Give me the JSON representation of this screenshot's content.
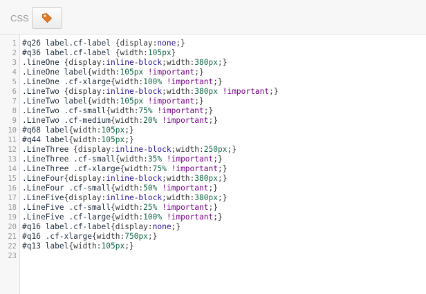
{
  "toolbar": {
    "mode_label": "CSS",
    "tag_button_icon": "tag-icon",
    "accent": "#e07a26"
  },
  "editor": {
    "lines": [
      [
        [
          "#q26 label.cf-label ",
          "sel"
        ],
        [
          "{",
          "punc"
        ],
        [
          "display",
          "prop"
        ],
        [
          ":",
          "punc"
        ],
        [
          "none",
          "kw"
        ],
        [
          ";}",
          "punc"
        ]
      ],
      [
        [
          "#q36 label.cf-label ",
          "sel"
        ],
        [
          "{",
          "punc"
        ],
        [
          "width",
          "prop"
        ],
        [
          ":",
          "punc"
        ],
        [
          "105px",
          "val"
        ],
        [
          "}",
          "punc"
        ]
      ],
      [
        [
          ".lineOne ",
          "sel"
        ],
        [
          "{",
          "punc"
        ],
        [
          "display",
          "prop"
        ],
        [
          ":",
          "punc"
        ],
        [
          "inline-block",
          "kw"
        ],
        [
          ";",
          "punc"
        ],
        [
          "width",
          "prop"
        ],
        [
          ":",
          "punc"
        ],
        [
          "380px",
          "val"
        ],
        [
          ";}",
          "punc"
        ]
      ],
      [
        [
          ".LineOne label",
          "sel"
        ],
        [
          "{",
          "punc"
        ],
        [
          "width",
          "prop"
        ],
        [
          ":",
          "punc"
        ],
        [
          "105px ",
          "val"
        ],
        [
          "!important",
          "imp"
        ],
        [
          ";}",
          "punc"
        ]
      ],
      [
        [
          ".LineOne .cf-xlarge",
          "sel"
        ],
        [
          "{",
          "punc"
        ],
        [
          "width",
          "prop"
        ],
        [
          ":",
          "punc"
        ],
        [
          "100% ",
          "val"
        ],
        [
          "!important",
          "imp"
        ],
        [
          ";}",
          "punc"
        ]
      ],
      [
        [
          ".LineTwo ",
          "sel"
        ],
        [
          "{",
          "punc"
        ],
        [
          "display",
          "prop"
        ],
        [
          ":",
          "punc"
        ],
        [
          "inline-block",
          "kw"
        ],
        [
          ";",
          "punc"
        ],
        [
          "width",
          "prop"
        ],
        [
          ":",
          "punc"
        ],
        [
          "380px ",
          "val"
        ],
        [
          "!important",
          "imp"
        ],
        [
          ";}",
          "punc"
        ]
      ],
      [
        [
          ".LineTwo label",
          "sel"
        ],
        [
          "{",
          "punc"
        ],
        [
          "width",
          "prop"
        ],
        [
          ":",
          "punc"
        ],
        [
          "105px ",
          "val"
        ],
        [
          "!important",
          "imp"
        ],
        [
          ";}",
          "punc"
        ]
      ],
      [
        [
          ".LineTwo .cf-small",
          "sel"
        ],
        [
          "{",
          "punc"
        ],
        [
          "width",
          "prop"
        ],
        [
          ":",
          "punc"
        ],
        [
          "75% ",
          "val"
        ],
        [
          "!important",
          "imp"
        ],
        [
          ";}",
          "punc"
        ]
      ],
      [
        [
          ".LineTwo .cf-medium",
          "sel"
        ],
        [
          "{",
          "punc"
        ],
        [
          "width",
          "prop"
        ],
        [
          ":",
          "punc"
        ],
        [
          "20% ",
          "val"
        ],
        [
          "!important",
          "imp"
        ],
        [
          ";}",
          "punc"
        ]
      ],
      [
        [
          "#q68 label",
          "sel"
        ],
        [
          "{",
          "punc"
        ],
        [
          "width",
          "prop"
        ],
        [
          ":",
          "punc"
        ],
        [
          "105px",
          "val"
        ],
        [
          ";}",
          "punc"
        ]
      ],
      [
        [
          "#q44 label",
          "sel"
        ],
        [
          "{",
          "punc"
        ],
        [
          "width",
          "prop"
        ],
        [
          ":",
          "punc"
        ],
        [
          "105px",
          "val"
        ],
        [
          ";}",
          "punc"
        ]
      ],
      [
        [
          ".LineThree ",
          "sel"
        ],
        [
          "{",
          "punc"
        ],
        [
          "display",
          "prop"
        ],
        [
          ":",
          "punc"
        ],
        [
          "inline-block",
          "kw"
        ],
        [
          ";",
          "punc"
        ],
        [
          "width",
          "prop"
        ],
        [
          ":",
          "punc"
        ],
        [
          "250px",
          "val"
        ],
        [
          ";}",
          "punc"
        ]
      ],
      [
        [
          ".LineThree .cf-small",
          "sel"
        ],
        [
          "{",
          "punc"
        ],
        [
          "width",
          "prop"
        ],
        [
          ":",
          "punc"
        ],
        [
          "35% ",
          "val"
        ],
        [
          "!important",
          "imp"
        ],
        [
          ";}",
          "punc"
        ]
      ],
      [
        [
          ".LineThree .cf-xlarge",
          "sel"
        ],
        [
          "{",
          "punc"
        ],
        [
          "width",
          "prop"
        ],
        [
          ":",
          "punc"
        ],
        [
          "75% ",
          "val"
        ],
        [
          "!important",
          "imp"
        ],
        [
          ";}",
          "punc"
        ]
      ],
      [
        [
          ".LineFour",
          "sel"
        ],
        [
          "{",
          "punc"
        ],
        [
          "display",
          "prop"
        ],
        [
          ":",
          "punc"
        ],
        [
          "inline-block",
          "kw"
        ],
        [
          ";",
          "punc"
        ],
        [
          "width",
          "prop"
        ],
        [
          ":",
          "punc"
        ],
        [
          "380px",
          "val"
        ],
        [
          ";}",
          "punc"
        ]
      ],
      [
        [
          ".LineFour .cf-small",
          "sel"
        ],
        [
          "{",
          "punc"
        ],
        [
          "width",
          "prop"
        ],
        [
          ":",
          "punc"
        ],
        [
          "50% ",
          "val"
        ],
        [
          "!important",
          "imp"
        ],
        [
          ";}",
          "punc"
        ]
      ],
      [
        [
          ".LineFive",
          "sel"
        ],
        [
          "{",
          "punc"
        ],
        [
          "display",
          "prop"
        ],
        [
          ":",
          "punc"
        ],
        [
          "inline-block",
          "kw"
        ],
        [
          ";",
          "punc"
        ],
        [
          "width",
          "prop"
        ],
        [
          ":",
          "punc"
        ],
        [
          "380px",
          "val"
        ],
        [
          ";}",
          "punc"
        ]
      ],
      [
        [
          ".LineFive .cf-small",
          "sel"
        ],
        [
          "{",
          "punc"
        ],
        [
          "width",
          "prop"
        ],
        [
          ":",
          "punc"
        ],
        [
          "25% ",
          "val"
        ],
        [
          "!important",
          "imp"
        ],
        [
          ";}",
          "punc"
        ]
      ],
      [
        [
          ".LineFive .cf-large",
          "sel"
        ],
        [
          "{",
          "punc"
        ],
        [
          "width",
          "prop"
        ],
        [
          ":",
          "punc"
        ],
        [
          "100% ",
          "val"
        ],
        [
          "!important",
          "imp"
        ],
        [
          ";}",
          "punc"
        ]
      ],
      [
        [
          "#q16 label.cf-label",
          "sel"
        ],
        [
          "{",
          "punc"
        ],
        [
          "display",
          "prop"
        ],
        [
          ":",
          "punc"
        ],
        [
          "none",
          "kw"
        ],
        [
          ";}",
          "punc"
        ]
      ],
      [
        [
          "#q16 .cf-xlarge",
          "sel"
        ],
        [
          "{",
          "punc"
        ],
        [
          "width",
          "prop"
        ],
        [
          ":",
          "punc"
        ],
        [
          "750px",
          "val"
        ],
        [
          ";}",
          "punc"
        ]
      ],
      [
        [
          "#q13 label",
          "sel"
        ],
        [
          "{",
          "punc"
        ],
        [
          "width",
          "prop"
        ],
        [
          ":",
          "punc"
        ],
        [
          "105px",
          "val"
        ],
        [
          ";}",
          "punc"
        ]
      ],
      []
    ]
  }
}
